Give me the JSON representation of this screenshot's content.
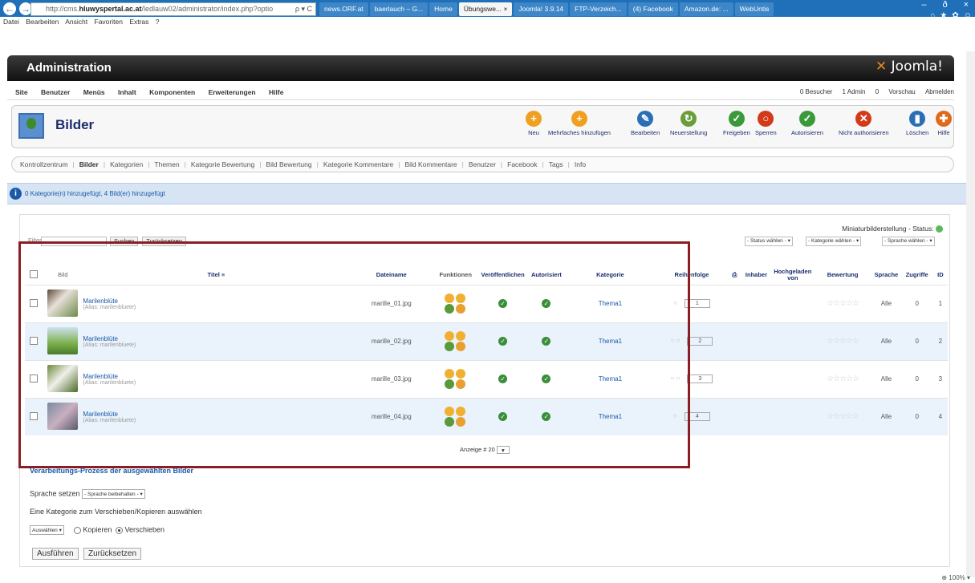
{
  "browser": {
    "url_prefix": "http://cms.",
    "url_host": "hluwyspertal.ac.at",
    "url_rest": "/ledlauw02/administrator/index.php?optio",
    "addr_ctl": "ρ ▾ C",
    "tabs": [
      "news.ORF.at",
      "baerlauch – G...",
      "Home",
      "Übungswe... ×",
      "Joomla! 3.9.14",
      "FTP-Verzeich...",
      "(4) Facebook",
      "Amazon.de: ...",
      "WebUntis"
    ],
    "win_ctl": [
      "–",
      "ð",
      "×"
    ],
    "fav_icons": [
      "⌂",
      "★",
      "✿",
      "☺"
    ],
    "menu": [
      "Datei",
      "Bearbeiten",
      "Ansicht",
      "Favoriten",
      "Extras",
      "?"
    ]
  },
  "admin": {
    "title": "Administration",
    "logo_x": "✕",
    "logo": "Joomla!"
  },
  "submenu": {
    "left": [
      "Site",
      "Benutzer",
      "Menüs",
      "Inhalt",
      "Komponenten",
      "Erweiterungen",
      "Hilfe"
    ],
    "right": [
      "0 Besucher",
      "1 Admin",
      "0",
      "Vorschau",
      "Abmelden"
    ]
  },
  "toolbar": {
    "page_title": "Bilder",
    "buttons": [
      {
        "label": "Neu",
        "color": "#f0a020",
        "glyph": "+"
      },
      {
        "label": "Mehrfaches hinzufügen",
        "color": "#f0a020",
        "glyph": "+"
      },
      {
        "label": "Bearbeiten",
        "color": "#2a6fb6",
        "glyph": "✎"
      },
      {
        "label": "Neuerstellung",
        "color": "#6a9e3a",
        "glyph": "↻"
      },
      {
        "label": "Freigeben",
        "color": "#3a9a3a",
        "glyph": "✓"
      },
      {
        "label": "Sperren",
        "color": "#d23a1a",
        "glyph": "○"
      },
      {
        "label": "Autorisieren",
        "color": "#3a9a3a",
        "glyph": "✓"
      },
      {
        "label": "Nicht authorisieren",
        "color": "#d23a1a",
        "glyph": "✕"
      },
      {
        "label": "Löschen",
        "color": "#2a6fb6",
        "glyph": "▮"
      },
      {
        "label": "Hilfe",
        "color": "#e06a1a",
        "glyph": "✚"
      }
    ]
  },
  "navbar": [
    "Kontrollzentrum",
    "Bilder",
    "Kategorien",
    "Themen",
    "Kategorie Bewertung",
    "Bild Bewertung",
    "Kategorie Kommentare",
    "Bild Kommentare",
    "Benutzer",
    "Facebook",
    "Tags",
    "Info"
  ],
  "message": "0 Kategorie(n) hinzugefügt, 4 Bild(er) hinzugefügt",
  "status": "Miniaturbilderstellung - Status:",
  "filters": {
    "search_label": "Filter",
    "search_btn": "Suchen",
    "reset_btn": "Zurücksetzen",
    "status": "- Status wählen -",
    "category": "- Kategorie wählen -",
    "language": "- Sprache wählen -"
  },
  "table": {
    "headers": {
      "image": "Bild",
      "title": "Titel",
      "filename": "Dateiname",
      "functions": "Funktionen",
      "published": "Veröffentlichen",
      "authorized": "Autorisiert",
      "category": "Kategorie",
      "order": "Reihenfolge",
      "owner": "Inhaber",
      "uploaded": "Hochgeladen von",
      "rating": "Bewertung",
      "language": "Sprache",
      "hits": "Zugriffe",
      "id": "ID"
    },
    "rows": [
      {
        "title": "Marilenblüte",
        "alias": "(Alias: marilenbluete)",
        "file": "marille_01.jpg",
        "cat": "Thema1",
        "order": "1",
        "lang": "Alle",
        "hits": "0",
        "id": "1",
        "stars": "☆☆☆☆☆",
        "order_dots": "○"
      },
      {
        "title": "Marilenblüte",
        "alias": "(Alias: marilenbluete)",
        "file": "marille_02.jpg",
        "cat": "Thema1",
        "order": "2",
        "lang": "Alle",
        "hits": "0",
        "id": "2",
        "stars": "☆☆☆☆☆",
        "order_dots": "○ ○"
      },
      {
        "title": "Marilenblüte",
        "alias": "(Alias: marilenbluete)",
        "file": "marille_03.jpg",
        "cat": "Thema1",
        "order": "3",
        "lang": "Alle",
        "hits": "0",
        "id": "3",
        "stars": "☆☆☆☆☆",
        "order_dots": "○ ○"
      },
      {
        "title": "Marilenblüte",
        "alias": "(Alias: marilenbluete)",
        "file": "marille_04.jpg",
        "cat": "Thema1",
        "order": "4",
        "lang": "Alle",
        "hits": "0",
        "id": "4",
        "stars": "☆☆☆☆☆",
        "order_dots": "○"
      }
    ]
  },
  "pager": {
    "label": "Anzeige # 20"
  },
  "process": {
    "title": "Verarbeitungs-Prozess der ausgewählten Bilder",
    "lang_label": "Sprache setzen",
    "lang_select": "- Sprache beibehalten -",
    "cat_label": "Eine Kategorie zum Verschieben/Kopieren auswählen",
    "cat_select": "Auswählen",
    "copy": "Kopieren",
    "move": "Verschieben",
    "run": "Ausführen",
    "reset": "Zurücksetzen"
  },
  "zoom": "⊕ 100% ▾"
}
